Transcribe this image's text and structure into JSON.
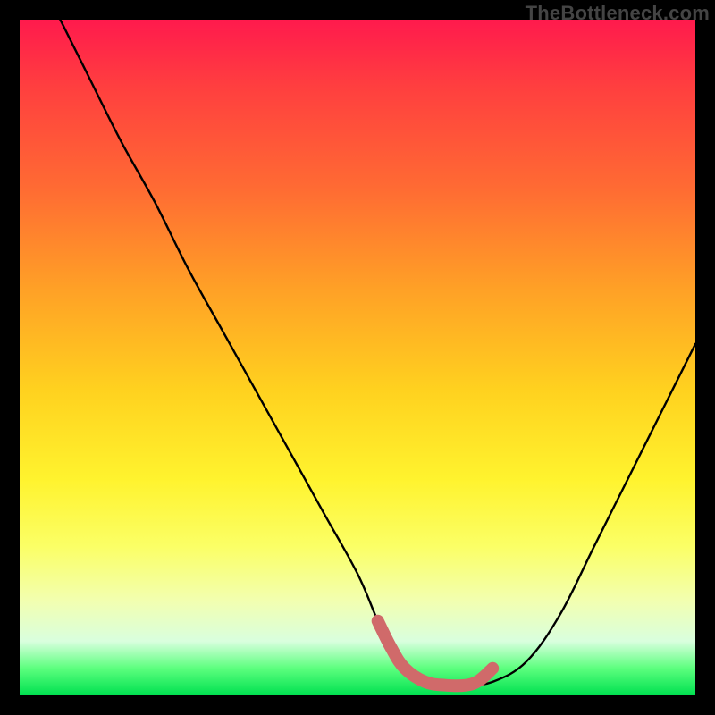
{
  "watermark": "TheBottleneck.com",
  "colors": {
    "frame": "#000000",
    "curve": "#000000",
    "marker": "#d06a6a"
  },
  "chart_data": {
    "type": "line",
    "title": "",
    "xlabel": "",
    "ylabel": "",
    "xlim": [
      0,
      100
    ],
    "ylim": [
      0,
      100
    ],
    "grid": false,
    "legend": false,
    "series": [
      {
        "name": "bottleneck-curve",
        "x": [
          6,
          10,
          15,
          20,
          25,
          30,
          35,
          40,
          45,
          50,
          53,
          55,
          57,
          60,
          63,
          66,
          70,
          75,
          80,
          85,
          90,
          95,
          100
        ],
        "y": [
          100,
          92,
          82,
          73,
          63,
          54,
          45,
          36,
          27,
          18,
          11,
          7,
          4,
          2,
          1.5,
          1.5,
          2,
          5,
          12,
          22,
          32,
          42,
          52
        ]
      }
    ],
    "markers": {
      "name": "highlight-band",
      "x": [
        53,
        55,
        57,
        60,
        63,
        66,
        68,
        70
      ],
      "y": [
        11,
        7,
        4,
        2,
        1.5,
        1.5,
        2.2,
        4
      ]
    }
  }
}
